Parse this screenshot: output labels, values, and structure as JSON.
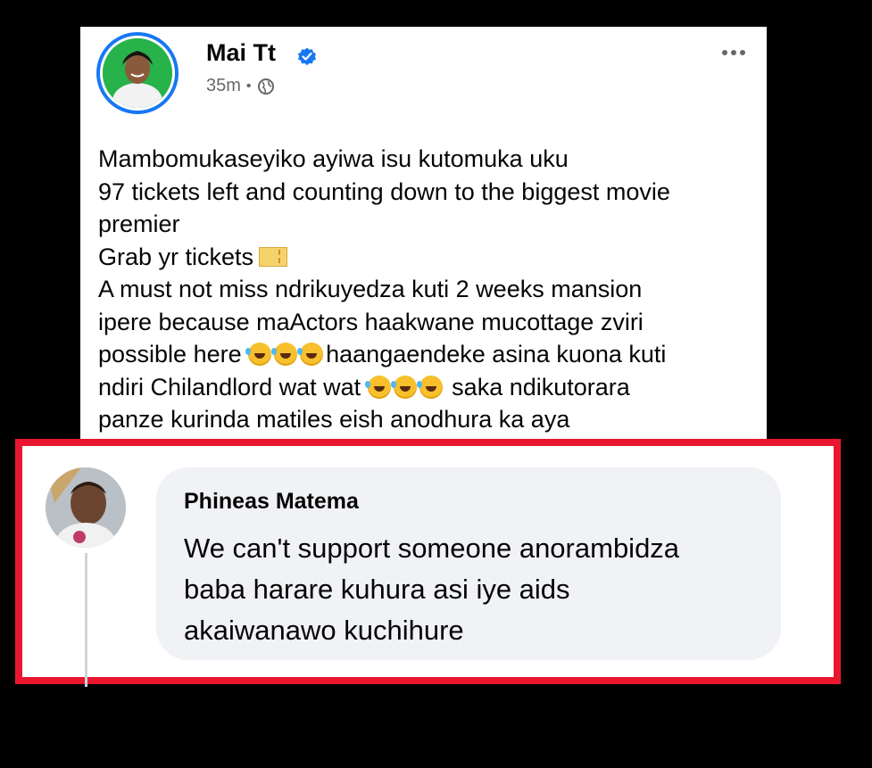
{
  "post": {
    "author": "Mai Tt",
    "verified": true,
    "time": "35m",
    "separator": "•",
    "audience_icon": "globe-icon",
    "menu_icon": "more-horizontal-icon",
    "lines": [
      "Mambomukaseyiko ayiwa isu kutomuka uku",
      "97 tickets left and counting down to the biggest movie",
      "premier",
      "Grab yr tickets",
      "A must not miss ndrikuyedza kuti 2 weeks mansion",
      "ipere because maActors haakwane mucottage zviri",
      "possible here",
      "haangaendeke asina kuona kuti",
      "ndiri Chilandlord wat wat",
      "saka ndikutorara",
      "panze kurinda matiles eish anodhura ka aya"
    ]
  },
  "comment": {
    "author": "Phineas Matema",
    "text_lines": [
      "We can't support someone  anorambidza",
      "baba harare kuhura asi iye aids",
      "akaiwanawo kuchihure"
    ]
  },
  "colors": {
    "verified": "#1877f2",
    "highlight_border": "#e8172f",
    "bubble": "#f0f2f5"
  }
}
